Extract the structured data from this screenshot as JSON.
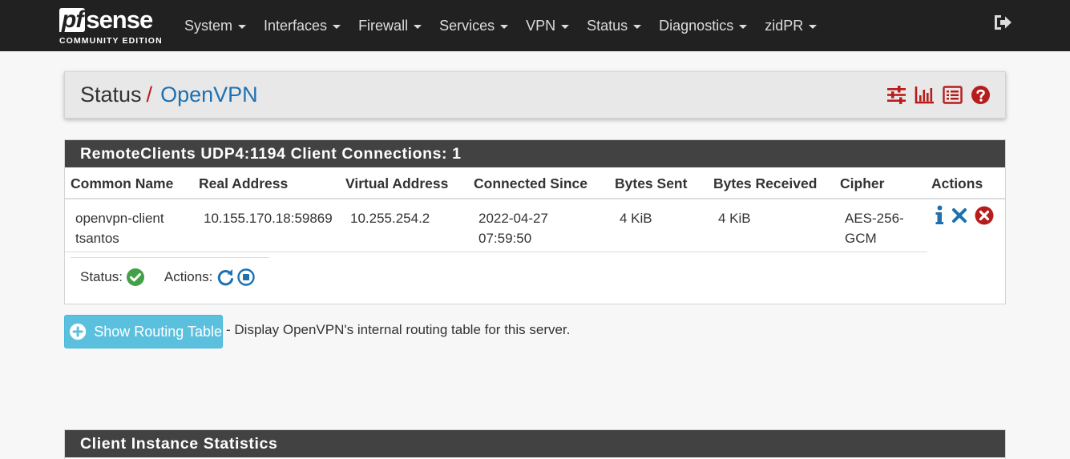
{
  "navbar": {
    "logo": {
      "pf": "pf",
      "sense": "sense",
      "edition": "COMMUNITY EDITION"
    },
    "menu": [
      {
        "label": "System"
      },
      {
        "label": "Interfaces"
      },
      {
        "label": "Firewall"
      },
      {
        "label": "Services"
      },
      {
        "label": "VPN"
      },
      {
        "label": "Status"
      },
      {
        "label": "Diagnostics"
      },
      {
        "label": "zidPR"
      }
    ],
    "logout_icon": "sign-out-icon"
  },
  "breadcrumb": {
    "parent": "Status",
    "separator": "/",
    "current": "OpenVPN",
    "icons": [
      "sliders-icon",
      "bar-chart-icon",
      "list-icon",
      "help-icon"
    ]
  },
  "server_panel": {
    "title": "RemoteClients UDP4:1194 Client Connections: 1",
    "columns": [
      "Common Name",
      "Real Address",
      "Virtual Address",
      "Connected Since",
      "Bytes Sent",
      "Bytes Received",
      "Cipher",
      "Actions"
    ],
    "rows": [
      {
        "common_name_1": "openvpn-client",
        "common_name_2": "tsantos",
        "real_address": "10.155.170.18:59869",
        "virtual_address": "10.255.254.2",
        "connected_date": "2022-04-27",
        "connected_time": "07:59:50",
        "bytes_sent": "4 KiB",
        "bytes_received": "4 KiB",
        "cipher_1": "AES-256-",
        "cipher_2": "GCM"
      }
    ],
    "status_label": "Status:",
    "actions_label": "Actions:"
  },
  "routing": {
    "button_label": "Show Routing Table",
    "description": "- Display OpenVPN's internal routing table for this server."
  },
  "stats_panel": {
    "title": "Client Instance Statistics"
  },
  "colors": {
    "navbar": "#212121",
    "panel_header": "#424242",
    "accent_red": "#b71c1c",
    "link_blue": "#1e70b0",
    "info_button": "#5bc0de",
    "success_green": "#43a047"
  }
}
